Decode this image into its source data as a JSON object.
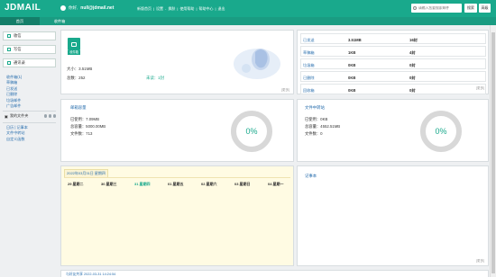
{
  "header": {
    "logo": "JDMAIL",
    "user_label": "你好,",
    "email": "null@jdmail.net",
    "links": [
      "新版首页",
      "|",
      "设置",
      "-",
      "换肤",
      "|",
      "使用帮助",
      "|",
      "帮助中心",
      "|",
      "退出"
    ],
    "search_placeholder": "请输入您要搜索邮件",
    "search_button": "搜索",
    "advanced_button": "高级"
  },
  "tabs": [
    "首页",
    "收件箱"
  ],
  "sidebar": {
    "buttons": [
      "收信",
      "写信",
      "通讯录"
    ],
    "folders": [
      "收件箱(1)",
      "草稿箱",
      "已发送",
      "已删除",
      "垃圾邮件",
      "广告邮件"
    ],
    "custom_title": "我的文件夹",
    "extras": [
      "日历 | 记事本",
      "文件中转站",
      "自定义函数"
    ]
  },
  "profile": {
    "badge": "收件箱",
    "size_label": "大小：3.51MB",
    "total_label": "总数：252",
    "unread_label": "未读：1封",
    "more": "[更多]"
  },
  "stats": [
    {
      "label": "已发送",
      "size": "3.51MB",
      "count": "16封"
    },
    {
      "label": "草稿箱",
      "size": "1KB",
      "count": "4封"
    },
    {
      "label": "垃圾箱",
      "size": "0KB",
      "count": "0封"
    },
    {
      "label": "已删除",
      "size": "0KB",
      "count": "0封"
    },
    {
      "label": "回收箱",
      "size": "0KB",
      "count": "0封"
    }
  ],
  "stats_more": "[更多]",
  "mailbox_quota": {
    "title": "邮箱容量",
    "used": "已使用：7.09MB",
    "total": "总容量：5000.00MB",
    "files": "文件数：713",
    "percent": "0%",
    "percent_value": 0
  },
  "file_quota": {
    "title": "文件中转站",
    "used": "已使用：0KB",
    "total": "总容量：4552.51MB",
    "files": "文件数：0",
    "percent": "0%",
    "percent_value": 0
  },
  "calendar": {
    "header": "2022年03月31日 星期四",
    "days": [
      "29 星期二",
      "30 星期三",
      "31 星期四",
      "01 星期五",
      "02 星期六",
      "03 星期日",
      "04 星期一"
    ],
    "today_index": 2
  },
  "notes": {
    "title": "记事本",
    "more": "[更多]"
  },
  "footer_text": "与好友共享  2022-03-31 14:24:54",
  "colors": {
    "brand": "#19a98c",
    "link": "#2a6fae",
    "calendar_bg": "#fffbe3"
  }
}
